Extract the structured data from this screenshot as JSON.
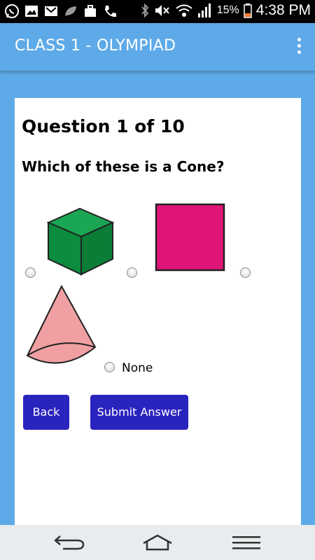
{
  "status_bar": {
    "left_icons": [
      "whatsapp-icon",
      "image-icon",
      "gmail-icon",
      "leaf-icon",
      "briefcase-icon",
      "phone-icon"
    ],
    "right_icons": [
      "bluetooth-icon",
      "mute-icon",
      "wifi-icon",
      "signal-icon",
      "battery-icon"
    ],
    "battery": "15%",
    "time": "4:38 PM"
  },
  "app_bar": {
    "title": "CLASS 1 - OLYMPIAD",
    "menu_icon": "more-vert-icon"
  },
  "quiz": {
    "counter": "Question 1 of 10",
    "question": "Which of these is a Cone?",
    "options": [
      {
        "shape": "cube",
        "color": "#0b9a4a"
      },
      {
        "shape": "square",
        "color": "#df1477"
      },
      {
        "shape": "cone",
        "color": "#f0a0a3"
      },
      {
        "label": "None"
      }
    ],
    "back_label": "Back",
    "submit_label": "Submit Answer"
  },
  "nav_bar": {
    "icons": [
      "back-arrow-icon",
      "home-icon",
      "menu-lines-icon"
    ]
  },
  "colors": {
    "accent": "#5eaae8",
    "button": "#2a24be",
    "nav_bg": "#e9ecef"
  }
}
